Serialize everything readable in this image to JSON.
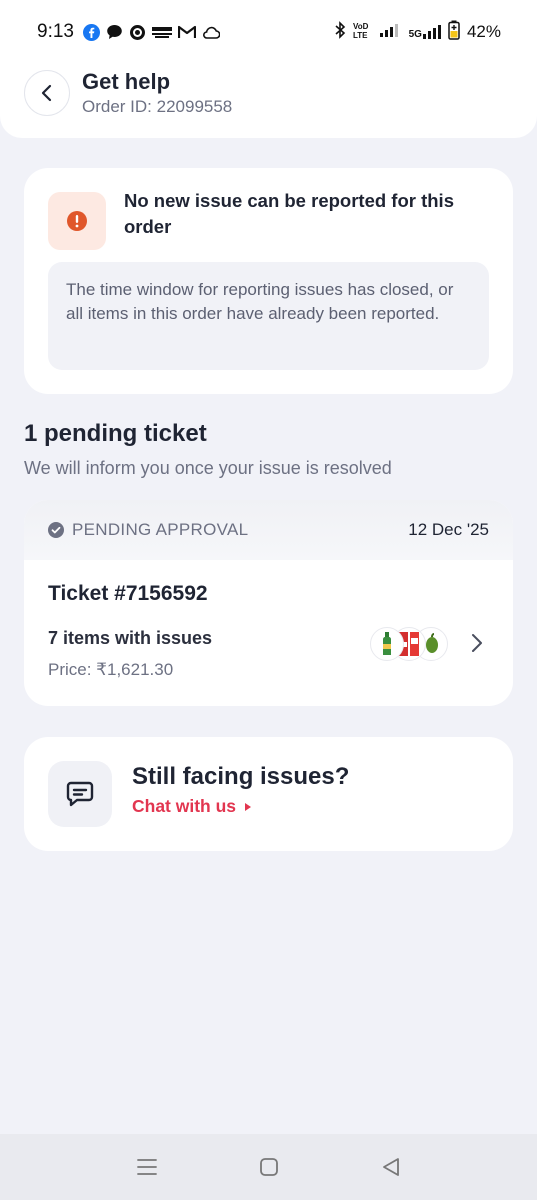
{
  "status_bar": {
    "time": "9:13",
    "battery": "42%",
    "network": "5G",
    "icons": [
      "facebook-icon",
      "chat-icon",
      "whatsapp-icon",
      "paytm-icon",
      "gmail-icon",
      "cloud-icon",
      "bluetooth-icon",
      "volte-icon",
      "signal-icon",
      "battery-icon"
    ]
  },
  "header": {
    "title": "Get help",
    "order_id": "Order ID: 22099558"
  },
  "notice": {
    "title": "No new issue can be reported for this order",
    "message": "The time window for reporting issues has closed, or all items in this order have already been reported.",
    "accent_color": "#e0572b",
    "tile_color": "#fde9e2"
  },
  "pending": {
    "title": "1 pending ticket",
    "subtitle": "We will inform you once your issue is resolved"
  },
  "ticket": {
    "status": "PENDING APPROVAL",
    "date": "12 Dec '25",
    "number": "Ticket #7156592",
    "items": "7 items with issues",
    "price": "Price: ₹1,621.30"
  },
  "help": {
    "title": "Still facing issues?",
    "link": "Chat with us",
    "link_color": "#e23650"
  },
  "nav": {
    "buttons": [
      "menu-icon",
      "home-icon",
      "back-icon"
    ]
  }
}
